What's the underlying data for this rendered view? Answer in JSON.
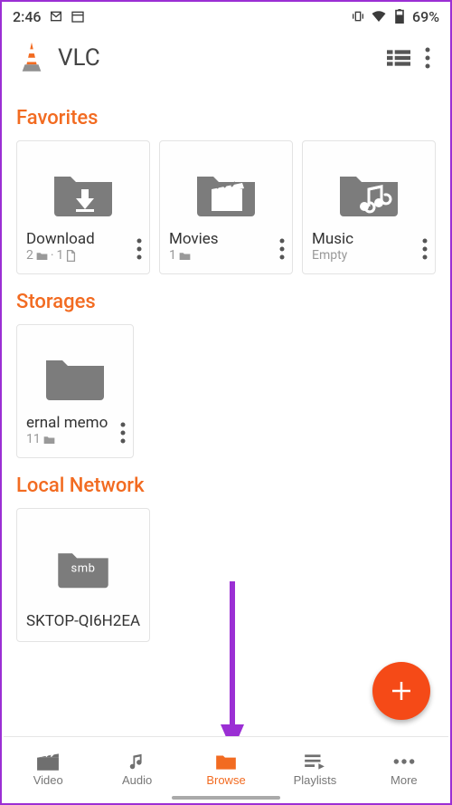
{
  "status": {
    "time": "2:46",
    "battery": "69%"
  },
  "appbar": {
    "title": "VLC"
  },
  "sections": {
    "favorites": {
      "title": "Favorites"
    },
    "storages": {
      "title": "Storages"
    },
    "network": {
      "title": "Local Network"
    }
  },
  "favorites": [
    {
      "label": "Download",
      "sub_folders": "2",
      "sub_files": "1"
    },
    {
      "label": "Movies",
      "sub_folders": "1"
    },
    {
      "label": "Music",
      "sub_empty": "Empty"
    }
  ],
  "storages": [
    {
      "label": "ernal memo",
      "sub_folders": "11"
    }
  ],
  "network": [
    {
      "label": "SKTOP-QI6H2EA",
      "protocol": "smb"
    }
  ],
  "fab": {
    "label": "+"
  },
  "nav": {
    "video": "Video",
    "audio": "Audio",
    "browse": "Browse",
    "playlists": "Playlists",
    "more": "More"
  }
}
